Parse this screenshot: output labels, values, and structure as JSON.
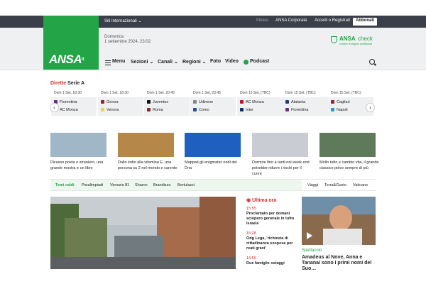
{
  "topbar": {
    "siti": "Siti Internazionali",
    "links": [
      "Meteo",
      "ANSA Corporate",
      "Accedi o Registrati"
    ],
    "abbonati": "Abbonati"
  },
  "header": {
    "logo": "ANSA",
    "logo_suffix": "it",
    "date_line1": "Domenica",
    "date_line2": "1 settembre 2024, 23:02",
    "check_brand": "ANSA",
    "check_word": "check",
    "check_sub": "notizie d'origine certificata"
  },
  "nav": {
    "menu": "Menu",
    "items": [
      "Sezioni",
      "Canali",
      "Regioni",
      "Foto",
      "Video",
      "Podcast"
    ]
  },
  "dirette": {
    "prefix": "Dirette",
    "name": "Serie A"
  },
  "matches": [
    {
      "date": "Dom 1 Set, 18:30",
      "home": "Fiorentina",
      "away": "AC Monza",
      "home_color": "#6b2c91",
      "away_color": "#c8102e"
    },
    {
      "date": "Dom 1 Set, 18:30",
      "home": "Genoa",
      "away": "Verona",
      "home_color": "#a6192e",
      "away_color": "#f4d03f"
    },
    {
      "date": "Dom 1 Set, 20:45",
      "home": "Juventus",
      "away": "Roma",
      "home_color": "#111111",
      "away_color": "#8e1f2f"
    },
    {
      "date": "Dom 1 Set, 20:45",
      "home": "Udinese",
      "away": "Como",
      "home_color": "#888888",
      "away_color": "#1f4e9c"
    },
    {
      "date": "Dom 15 Set, (TBC)",
      "home": "AC Monza",
      "away": "Inter",
      "home_color": "#c8102e",
      "away_color": "#0a2c6b"
    },
    {
      "date": "Dom 15 Set, (TBC)",
      "home": "Atalanta",
      "away": "Fiorentina",
      "home_color": "#1f3a8a",
      "away_color": "#6b2c91"
    },
    {
      "date": "Dom 15 Set, (TBC)",
      "home": "Cagliari",
      "away": "Napoli",
      "home_color": "#a6192e",
      "away_color": "#12a0d7"
    }
  ],
  "news": [
    {
      "caption": "Picasso poeta e straniero, una grande mostra e un libro",
      "color": "#9fb7c7"
    },
    {
      "caption": "Dallo iodio alla vitamina E, una persona su 2 nel mondo e carente",
      "color": "#b5884a"
    },
    {
      "caption": "Mappati gli enigmatici nodi del Dna",
      "color": "#1f5fbf"
    },
    {
      "caption": "Dormire fino a tardi nel week end potrebbe ridurre i rischi per il cuore",
      "color": "#c9ccd3"
    },
    {
      "caption": "Mollo tutto e cambio vita, il grande classico pièce sempre di più",
      "color": "#5f7a5a"
    }
  ],
  "temi": {
    "label": "Temi caldi",
    "items": [
      "Paralimpiadi",
      "Venezia 81",
      "Sharon",
      "Brandizzo",
      "Bertulazzi"
    ],
    "right": [
      "Viaggi",
      "Terra&Gusto",
      "Vaticano"
    ]
  },
  "ultima": {
    "title": "Ultima ora",
    "items": [
      {
        "time": "15:55",
        "text": "Proclamato per domani sciopero generale in tutto Israele"
      },
      {
        "time": "15:28",
        "text": "Odg Lega, 'richiesta di cittadinanza sospesa per reati gravi'"
      },
      {
        "time": "14:59",
        "text": "Due famiglie ostaggi"
      }
    ]
  },
  "side": {
    "category": "Spettacolo",
    "caption": "Amadeus al Nove, Anna e Tananai sono i primi nomi del Suo…"
  },
  "colors": {
    "brand_green": "#22a447",
    "topbar": "#3b3f4a",
    "accent_red": "#d32f2f"
  }
}
